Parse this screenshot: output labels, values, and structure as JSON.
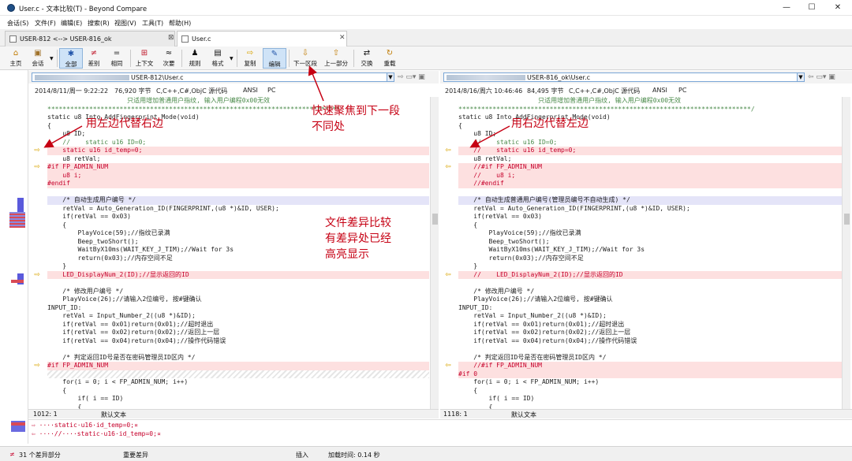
{
  "window": {
    "title": "User.c - 文本比较(T) - Beyond Compare",
    "minimize": "—",
    "maximize": "☐",
    "close": "✕"
  },
  "menu": [
    "会话(S)",
    "文件(F)",
    "编辑(E)",
    "搜索(R)",
    "视图(V)",
    "工具(T)",
    "帮助(H)"
  ],
  "tabs": [
    {
      "label": "USER-812 <--> USER-816_ok",
      "close": "⊠"
    },
    {
      "label": "User.c",
      "close": "✕"
    }
  ],
  "toolbar": [
    {
      "label": "主页",
      "icon": "⌂"
    },
    {
      "label": "会话",
      "icon": "▣"
    },
    {
      "label": "全部",
      "icon": "✱"
    },
    {
      "label": "差别",
      "icon": "≠"
    },
    {
      "label": "相同",
      "icon": "="
    },
    {
      "label": "上下文",
      "icon": "⊞"
    },
    {
      "label": "次要",
      "icon": "≈"
    },
    {
      "label": "规则",
      "icon": "♟"
    },
    {
      "label": "格式",
      "icon": "▤"
    },
    {
      "label": "复制",
      "icon": "⇨"
    },
    {
      "label": "编辑",
      "icon": "✎"
    },
    {
      "label": "下一区段",
      "icon": "⇩"
    },
    {
      "label": "上一部分",
      "icon": "⇧"
    },
    {
      "label": "交换",
      "icon": "⇄"
    },
    {
      "label": "重载",
      "icon": "↻"
    }
  ],
  "left": {
    "path": "USER-812\\User.c",
    "info": {
      "date": "2014/8/11/周一 9:22:22",
      "size": "76,920 字节",
      "lang": "C,C++,C#,ObjC 源代码",
      "enc": "ANSI",
      "eol": "PC"
    },
    "status": {
      "pos": "1012: 1",
      "mode": "默认文本"
    },
    "lines": [
      {
        "t": "                     只适用增加普通用户指纹, 输入用户编程0x00无效",
        "k": "g"
      },
      {
        "t": "*****************************************************************************",
        "k": "g"
      },
      {
        "t": "static u8 Into_AddFingerprint_Mode(void)",
        "k": ""
      },
      {
        "t": "{",
        "k": ""
      },
      {
        "t": "    u8 ID;",
        "k": ""
      },
      {
        "t": "    //    static u16 ID=0;",
        "k": "cm"
      },
      {
        "t": "    static u16 id_temp=0;",
        "k": "diff"
      },
      {
        "t": "    u8 retVal;",
        "k": ""
      },
      {
        "t": "#if FP_ADMIN_NUM",
        "k": "diff"
      },
      {
        "t": "    u8 i;",
        "k": "diff"
      },
      {
        "t": "#endif",
        "k": "diff"
      },
      {
        "t": "",
        "k": ""
      },
      {
        "t": "    /* 自动生成用户编号 */",
        "k": "mark"
      },
      {
        "t": "    retVal = Auto_Generation_ID(FINGERPRINT,(u8 *)&ID, USER);",
        "k": ""
      },
      {
        "t": "    if(retVal == 0x03)",
        "k": ""
      },
      {
        "t": "    {",
        "k": ""
      },
      {
        "t": "        PlayVoice(59);//指纹已录满",
        "k": ""
      },
      {
        "t": "        Beep_twoShort();",
        "k": ""
      },
      {
        "t": "        WaitByX10ms(WAIT_KEY_J_TIM);//Wait for 3s",
        "k": ""
      },
      {
        "t": "        return(0x03);//内存空间不足",
        "k": ""
      },
      {
        "t": "    }",
        "k": ""
      },
      {
        "t": "    LED_DisplayNum_2(ID);//显示返回的ID",
        "k": "diff"
      },
      {
        "t": "",
        "k": ""
      },
      {
        "t": "    /* 修改用户编号 */",
        "k": ""
      },
      {
        "t": "    PlayVoice(26);//请输入2位编号, 按#键确认",
        "k": ""
      },
      {
        "t": "INPUT_ID:",
        "k": ""
      },
      {
        "t": "    retVal = Input_Number_2((u8 *)&ID);",
        "k": ""
      },
      {
        "t": "    if(retVal == 0x01)return(0x01);//超时退出",
        "k": ""
      },
      {
        "t": "    if(retVal == 0x02)return(0x02);//返回上一层",
        "k": ""
      },
      {
        "t": "    if(retVal == 0x04)return(0x04);//操作代码错误",
        "k": ""
      },
      {
        "t": "",
        "k": ""
      },
      {
        "t": "    /* 判定返回ID号是否在密码管理员ID区内 */",
        "k": ""
      },
      {
        "t": "#if FP_ADMIN_NUM",
        "k": "diff"
      },
      {
        "t": "",
        "k": "hatch"
      },
      {
        "t": "    for(i = 0; i < FP_ADMIN_NUM; i++)",
        "k": ""
      },
      {
        "t": "    {",
        "k": ""
      },
      {
        "t": "        if( i == ID)",
        "k": ""
      },
      {
        "t": "        {",
        "k": ""
      }
    ]
  },
  "right": {
    "path": "USER-816_ok\\User.c",
    "info": {
      "date": "2014/8/16/周六 10:46:46",
      "size": "84,495 字节",
      "lang": "C,C++,C#,ObjC 源代码",
      "enc": "ANSI",
      "eol": "PC"
    },
    "status": {
      "pos": "1118: 1",
      "mode": "默认文本"
    },
    "lines": [
      {
        "t": "                     只适用增加普通用户指纹, 输入用户编程0x00无效",
        "k": "g"
      },
      {
        "t": "*****************************************************************************/",
        "k": "g"
      },
      {
        "t": "static u8 Into_AddFingerprint_Mode(void)",
        "k": ""
      },
      {
        "t": "{",
        "k": ""
      },
      {
        "t": "    u8 ID;",
        "k": ""
      },
      {
        "t": "    //    static u16 ID=0;",
        "k": "cm"
      },
      {
        "t": "    //    static u16 id_temp=0;",
        "k": "diff"
      },
      {
        "t": "    u8 retVal;",
        "k": ""
      },
      {
        "t": "    //#if FP_ADMIN_NUM",
        "k": "diff"
      },
      {
        "t": "    //    u8 i;",
        "k": "diff"
      },
      {
        "t": "    //#endif",
        "k": "diff"
      },
      {
        "t": "",
        "k": ""
      },
      {
        "t": "    /* 自动生成普通用户编号(管理员编号不自动生成) */",
        "k": "mark"
      },
      {
        "t": "    retVal = Auto_Generation_ID(FINGERPRINT,(u8 *)&ID, USER);",
        "k": ""
      },
      {
        "t": "    if(retVal == 0x03)",
        "k": ""
      },
      {
        "t": "    {",
        "k": ""
      },
      {
        "t": "        PlayVoice(59);//指纹已录满",
        "k": ""
      },
      {
        "t": "        Beep_twoShort();",
        "k": ""
      },
      {
        "t": "        WaitByX10ms(WAIT_KEY_J_TIM);//Wait for 3s",
        "k": ""
      },
      {
        "t": "        return(0x03);//内存空间不足",
        "k": ""
      },
      {
        "t": "    }",
        "k": ""
      },
      {
        "t": "    //    LED_DisplayNum_2(ID);//显示返回的ID",
        "k": "diff"
      },
      {
        "t": "",
        "k": ""
      },
      {
        "t": "    /* 修改用户编号 */",
        "k": ""
      },
      {
        "t": "    PlayVoice(26);//请输入2位编号, 按#键确认",
        "k": ""
      },
      {
        "t": "INPUT_ID:",
        "k": ""
      },
      {
        "t": "    retVal = Input_Number_2((u8 *)&ID);",
        "k": ""
      },
      {
        "t": "    if(retVal == 0x01)return(0x01);//超时退出",
        "k": ""
      },
      {
        "t": "    if(retVal == 0x02)return(0x02);//返回上一层",
        "k": ""
      },
      {
        "t": "    if(retVal == 0x04)return(0x04);//操作代码错误",
        "k": ""
      },
      {
        "t": "",
        "k": ""
      },
      {
        "t": "    /* 判定返回ID号是否在密码管理员ID区内 */",
        "k": ""
      },
      {
        "t": "    //#if FP_ADMIN_NUM",
        "k": "diff"
      },
      {
        "t": "#if 0",
        "k": "diff"
      },
      {
        "t": "    for(i = 0; i < FP_ADMIN_NUM; i++)",
        "k": ""
      },
      {
        "t": "    {",
        "k": ""
      },
      {
        "t": "        if( i == ID)",
        "k": ""
      },
      {
        "t": "        {",
        "k": ""
      }
    ]
  },
  "bottom": {
    "line1": "⇨ ····static·u16·id_temp=0;¤",
    "line2": "⇦ ····//····static·u16·id_temp=0;¤"
  },
  "statusline": {
    "diffs": "31 个差异部分",
    "kind": "重要差异",
    "mode": "插入",
    "loadtime": "加载时间: 0.14 秒"
  },
  "annotations": {
    "left_replace": "用左边代替右边",
    "right_replace": "用右边代替左边",
    "next_section": "快速聚焦到下一段\n不同处",
    "highlight": "文件差异比较\n有差异处已经\n高亮显示"
  },
  "colors": {
    "diff_bg": "#fde0e0",
    "accent": "#c60013",
    "arrow": "#d9a400"
  }
}
